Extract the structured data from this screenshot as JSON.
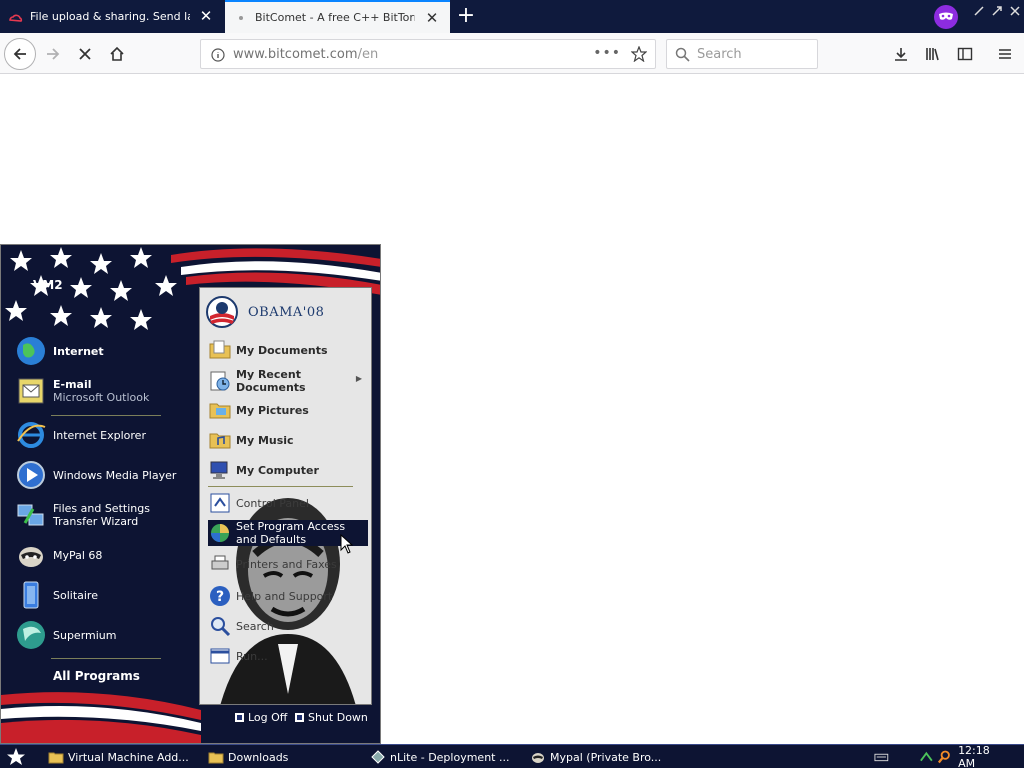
{
  "browser": {
    "tabs": [
      {
        "label": "File upload & sharing. Send large p",
        "active": false
      },
      {
        "label": "BitComet - A free C++ BitTorrent",
        "active": true
      }
    ],
    "url": {
      "host": "www.bitcomet.com",
      "path": "/en"
    },
    "search_placeholder": "Search"
  },
  "start_menu": {
    "user": "VM2",
    "pinned": [
      {
        "title": "Internet",
        "sub": ""
      },
      {
        "title": "E-mail",
        "sub": "Microsoft Outlook"
      }
    ],
    "recent": [
      {
        "title": "Internet Explorer"
      },
      {
        "title": "Windows Media Player"
      },
      {
        "title": "Files and Settings Transfer Wizard"
      },
      {
        "title": "MyPal 68"
      },
      {
        "title": "Solitaire"
      },
      {
        "title": "Supermium"
      }
    ],
    "all_programs": "All Programs",
    "right": {
      "brand": "OBAMA'08",
      "items": [
        "My Documents",
        "My Recent Documents",
        "My Pictures",
        "My Music",
        "My Computer",
        "Control Panel",
        "Set Program Access and Defaults",
        "Printers and Faxes",
        "Help and Support",
        "Search",
        "Run..."
      ]
    },
    "log_off": "Log Off",
    "shut_down": "Shut Down"
  },
  "taskbar": {
    "tasks": [
      {
        "label": "Virtual Machine Add..."
      },
      {
        "label": "Downloads"
      },
      {
        "label": "nLite - Deployment ..."
      },
      {
        "label": "Mypal (Private Bro..."
      }
    ],
    "clock": "12:18 AM"
  },
  "colors": {
    "tabbar": "#0f1a3d",
    "accent": "#0a84ff",
    "startmenu_bg": "#0d1433",
    "taskbar": "#0d1433"
  }
}
